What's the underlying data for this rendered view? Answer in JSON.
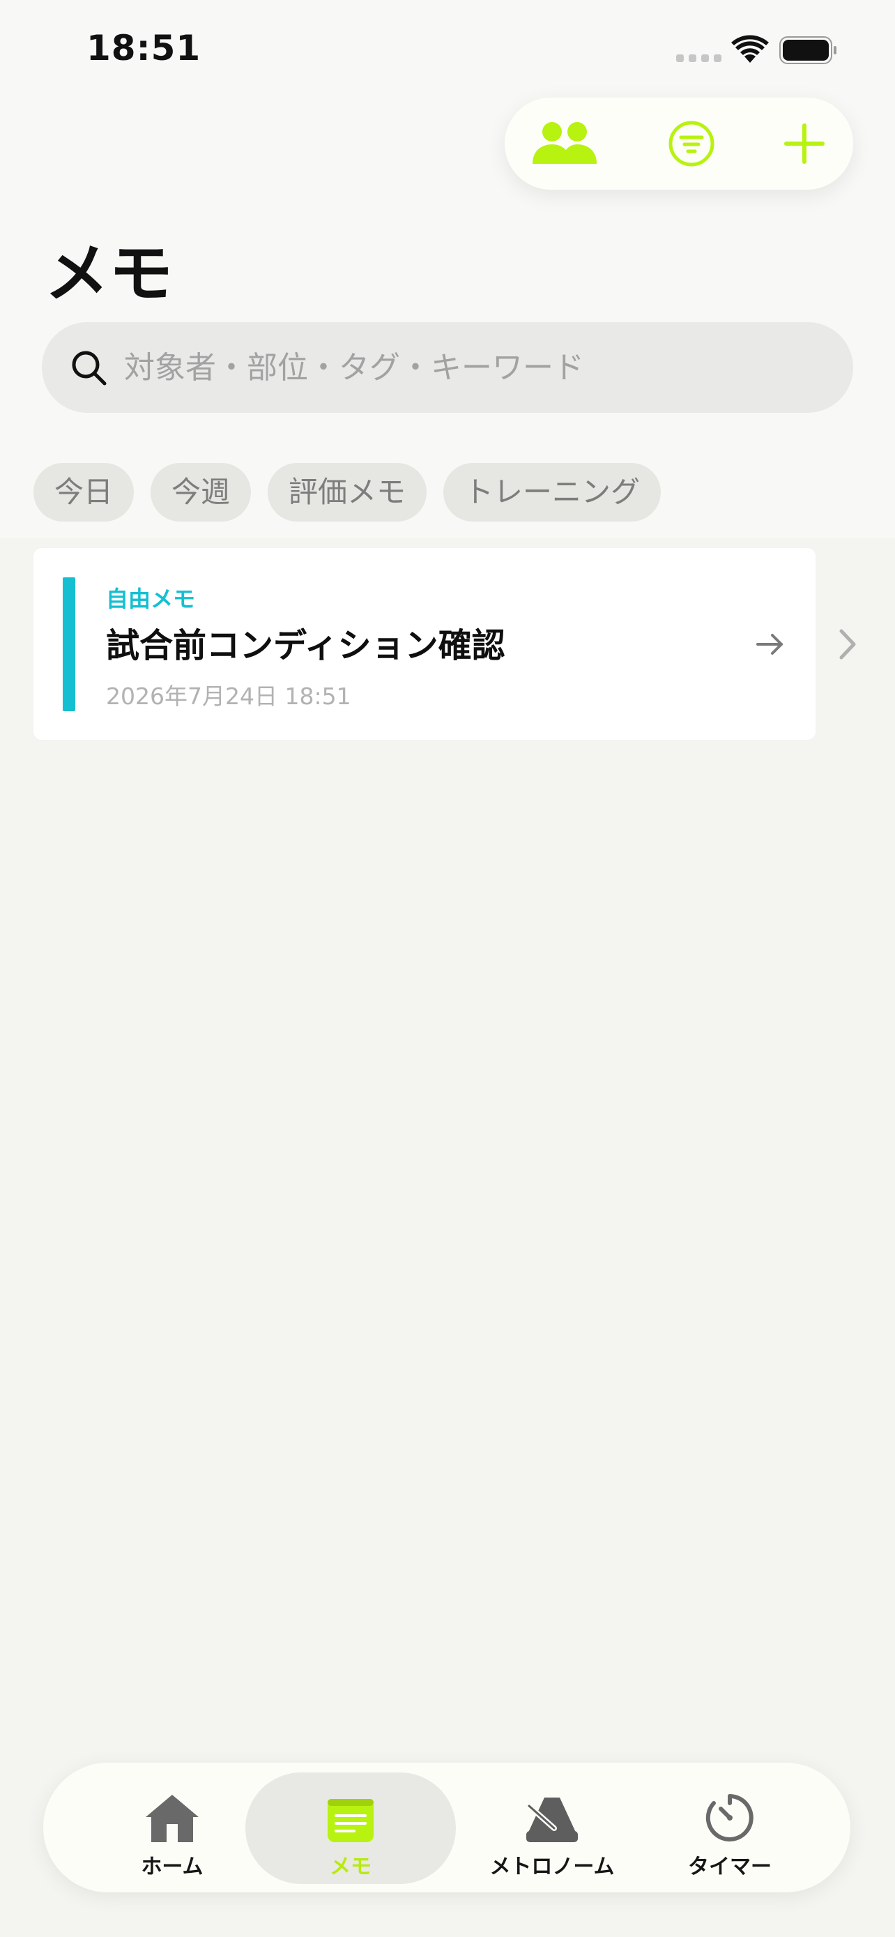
{
  "status_bar": {
    "time": "18:51"
  },
  "colors": {
    "accent": "#b8f210",
    "memo_type": "#15bfd2",
    "background": "#f4f4f0"
  },
  "actions": {
    "users_icon": "people-icon",
    "filter_icon": "filter-icon",
    "add_icon": "plus-icon"
  },
  "page": {
    "title": "メモ"
  },
  "search": {
    "placeholder": "対象者・部位・タグ・キーワード",
    "value": ""
  },
  "filters": [
    "今日",
    "今週",
    "評価メモ",
    "トレーニング"
  ],
  "memos": [
    {
      "type": "自由メモ",
      "title": "試合前コンディション確認",
      "date": "2026年7月24日 18:51"
    }
  ],
  "tabbar": {
    "items": [
      {
        "label": "ホーム",
        "icon": "house-icon"
      },
      {
        "label": "メモ",
        "icon": "memo-icon",
        "active": true
      },
      {
        "label": "メトロノーム",
        "icon": "metronome-icon"
      },
      {
        "label": "タイマー",
        "icon": "timer-icon"
      }
    ]
  }
}
